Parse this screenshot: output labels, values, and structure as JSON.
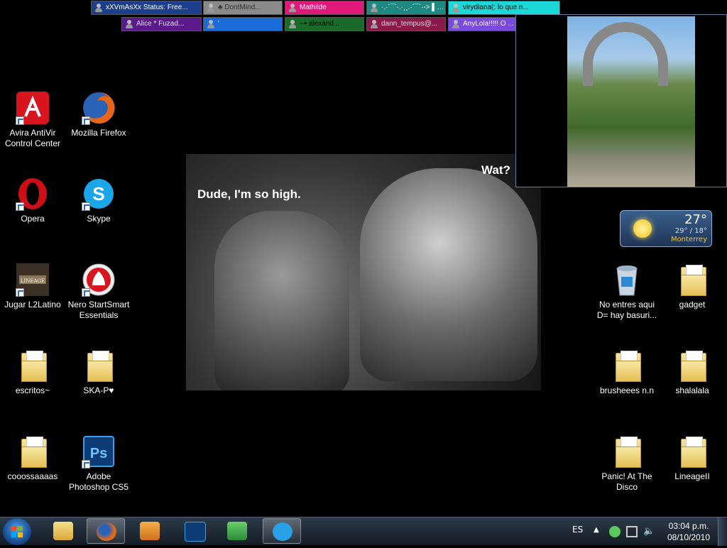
{
  "contact_tabs": [
    {
      "label": "xXVmAsXx Status: Free...",
      "color": "#1c3f8c",
      "text_color": "#ffffff"
    },
    {
      "label": "♣ DontMind...",
      "color": "#8a8a8a",
      "text_color": "#333333"
    },
    {
      "label": "Mathilde",
      "color": "#e0187a",
      "text_color": "#ffffff"
    },
    {
      "label": "·.·´¯`·.·¸¸.·´¯`·-> ▌▌▌▌▌ ...",
      "color": "#1c8a82",
      "text_color": "#ffffff"
    },
    {
      "label": "virydiana(:          lo que n...",
      "color": "#1bd8d8",
      "text_color": "#000000"
    },
    {
      "label": "Alice * Fuzad...",
      "color": "#5a1a8c",
      "text_color": "#e0e0e0"
    },
    {
      "label": "'",
      "color": "#1a6ad8",
      "text_color": "#ffffff"
    },
    {
      "label": "--• alexand...",
      "color": "#1a6a2a",
      "text_color": "#000000"
    },
    {
      "label": "dann_tempus@...",
      "color": "#8a1a4a",
      "text_color": "#dddddd"
    },
    {
      "label": "AnyLola!!!!! O ...",
      "color": "#7a4ae0",
      "text_color": "#ffffff"
    }
  ],
  "desktop_icons_left": [
    {
      "label": "Avira AntiVir Control Center",
      "icon": "avira-icon"
    },
    {
      "label": "Mozilla Firefox",
      "icon": "firefox-icon"
    },
    {
      "label": "Opera",
      "icon": "opera-icon"
    },
    {
      "label": "Skype",
      "icon": "skype-icon"
    },
    {
      "label": "Jugar L2Latino",
      "icon": "lineage-icon"
    },
    {
      "label": "Nero StartSmart Essentials",
      "icon": "nero-icon"
    },
    {
      "label": "escritos~",
      "icon": "folder-icon"
    },
    {
      "label": "SKA-P♥",
      "icon": "folder-icon"
    },
    {
      "label": "cooossaaaas",
      "icon": "folder-icon"
    },
    {
      "label": "Adobe Photoshop CS5",
      "icon": "photoshop-icon"
    }
  ],
  "desktop_icons_right": [
    {
      "label": "No entres aqui D= hay basuri...",
      "icon": "recycle-bin-icon"
    },
    {
      "label": "gadget",
      "icon": "folder-icon"
    },
    {
      "label": "brusheees n.n",
      "icon": "folder-icon"
    },
    {
      "label": "shalalala",
      "icon": "folder-icon"
    },
    {
      "label": "Panic! At The Disco",
      "icon": "folder-icon"
    },
    {
      "label": "LineageII",
      "icon": "folder-icon"
    }
  ],
  "wallpaper": {
    "caption_left": "Dude, I'm so high.",
    "caption_right": "Wat?"
  },
  "weather": {
    "temperature": "27°",
    "range": "29° / 18°",
    "city": "Monterrey"
  },
  "taskbar": {
    "buttons": [
      {
        "name": "explorer-icon",
        "active": false,
        "color": "#e8b84a"
      },
      {
        "name": "firefox-icon",
        "active": true,
        "color": "#e06a1a"
      },
      {
        "name": "media-player-icon",
        "active": false,
        "color": "#e08a2a"
      },
      {
        "name": "photoshop-icon",
        "active": false,
        "color": "#1a4a9a"
      },
      {
        "name": "messenger-icon",
        "active": false,
        "color": "#3aa04a"
      },
      {
        "name": "skype-icon",
        "active": true,
        "color": "#2aa0e6"
      }
    ],
    "language": "ES",
    "time": "03:04 p.m.",
    "date": "08/10/2010"
  }
}
